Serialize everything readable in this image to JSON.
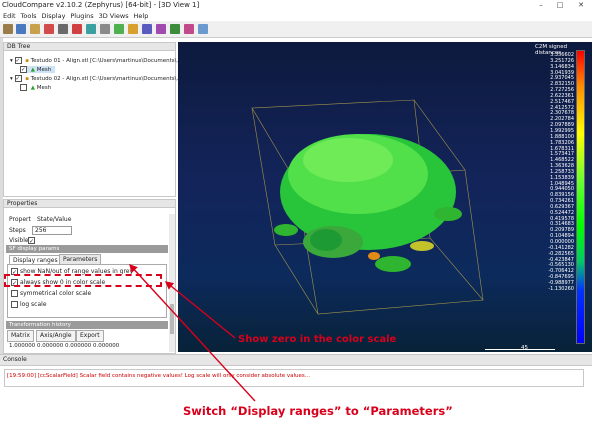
{
  "window": {
    "title": "CloudCompare v2.10.2 (Zephyrus) [64-bit] - [3D View 1]",
    "minimize": "–",
    "maximize": "□",
    "close": "✕"
  },
  "menu": [
    "Edit",
    "Tools",
    "Display",
    "Plugins",
    "3D Views",
    "Help"
  ],
  "db_tree": {
    "header": "DB Tree",
    "items": [
      {
        "label": "Testudo 01 - Align.stl [C:\\Users\\martinus\\Documents\\...",
        "checked": true
      },
      {
        "label": "Mesh",
        "checked": true,
        "selected": true
      },
      {
        "label": "Testudo 02 - Align.stl [C:\\Users\\martinus\\Documents\\...",
        "checked": true
      },
      {
        "label": "Mesh",
        "checked": false
      }
    ]
  },
  "properties": {
    "header": "Properties",
    "col_property": "Propert",
    "col_value": "State/Value",
    "steps_label": "Steps",
    "steps_value": "256",
    "visible_label": "Visible",
    "section": "SF display params",
    "tabs": [
      "Display ranges",
      "Parameters"
    ],
    "options": [
      {
        "label": "show NaN/out of range values in grey",
        "checked": true
      },
      {
        "label": "always show 0 in color scale",
        "checked": true
      },
      {
        "label": "symmetrical color scale",
        "checked": false
      },
      {
        "label": "log scale",
        "checked": false
      }
    ],
    "transform_header": "Transformation history",
    "transform_tabs": [
      "Matrix",
      "Axis/Angle",
      "Export"
    ],
    "matrix_row": "1.000000 0.000000 0.000000 0.000000"
  },
  "view": {
    "scale_title": "C2M signed distances",
    "scale_values": [
      "3.356602",
      "3.251726",
      "3.146834",
      "3.041939",
      "2.937045",
      "2.832150",
      "2.727256",
      "2.622361",
      "2.517467",
      "2.412572",
      "2.307678",
      "2.202784",
      "2.097889",
      "1.992995",
      "1.888100",
      "1.783206",
      "1.678311",
      "1.573417",
      "1.468522",
      "1.363628",
      "1.258733",
      "1.153839",
      "1.048945",
      "0.944050",
      "0.839156",
      "0.734261",
      "0.629367",
      "0.524472",
      "0.419578",
      "0.314683",
      "0.209789",
      "0.104894",
      "0.000000",
      "-0.141282",
      "-0.282565",
      "-0.423847",
      "-0.565130",
      "-0.706412",
      "-0.847695",
      "-0.988977",
      "-1.130260"
    ],
    "scale_bar_value": "45"
  },
  "console": {
    "header": "Console",
    "line": "[19:59:00] [ccScalarField] Scalar field contains negative values! Log scale will only consider absolute values..."
  },
  "annotations": {
    "zero_label": "Show zero in the color scale",
    "switch_label": "Switch “Display ranges” to “Parameters”"
  },
  "colors": {
    "annotation": "#d9001b",
    "mesh": "#22cc33"
  }
}
